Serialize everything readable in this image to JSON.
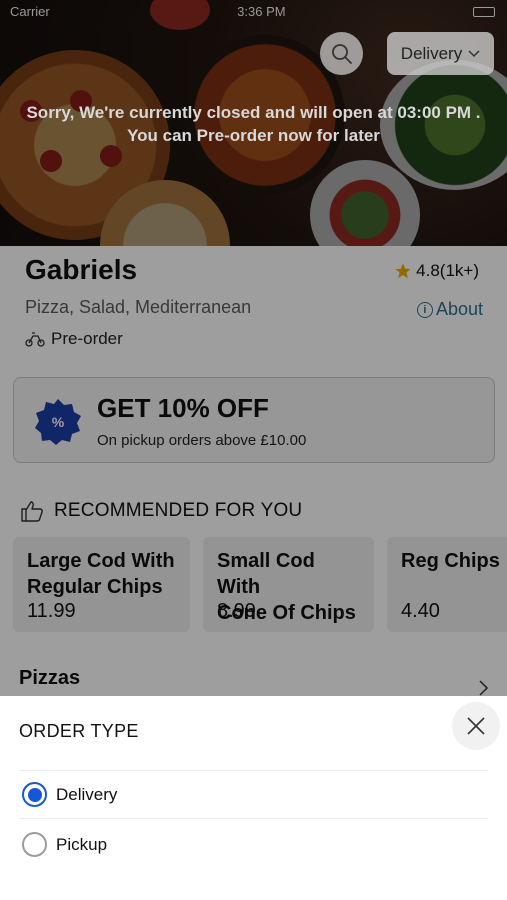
{
  "status_bar": {
    "carrier": "Carrier",
    "time": "3:36 PM"
  },
  "header": {
    "delivery_button_label": "Delivery",
    "closed_message_line1": "Sorry, We're currently closed and will open at 03:00 PM .",
    "closed_message_line2": "You can Pre-order now for later"
  },
  "restaurant": {
    "name": "Gabriels",
    "rating": "4.8(1k+)",
    "cuisine": "Pizza, Salad, Mediterranean",
    "about_label": "About",
    "preorder_label": "Pre-order"
  },
  "promo": {
    "title": "GET 10% OFF",
    "subtitle": "On pickup orders above £10.00",
    "accent": "#1a3ea6"
  },
  "recommended": {
    "heading": "RECOMMENDED FOR YOU",
    "items": [
      {
        "title_line1": "Large Cod With",
        "title_line2": "Regular Chips",
        "price": "11.99"
      },
      {
        "title_line1": "Small Cod With",
        "title_line2": "Cone Of Chips",
        "price": "8.99"
      },
      {
        "title_line1": "Reg Chips",
        "title_line2": "",
        "price": "4.40"
      }
    ]
  },
  "menu": {
    "first_section": "Pizzas"
  },
  "order_type_sheet": {
    "title": "ORDER TYPE",
    "options": [
      {
        "label": "Delivery",
        "selected": true
      },
      {
        "label": "Pickup",
        "selected": false
      }
    ],
    "selected_color": "#1756d6"
  }
}
